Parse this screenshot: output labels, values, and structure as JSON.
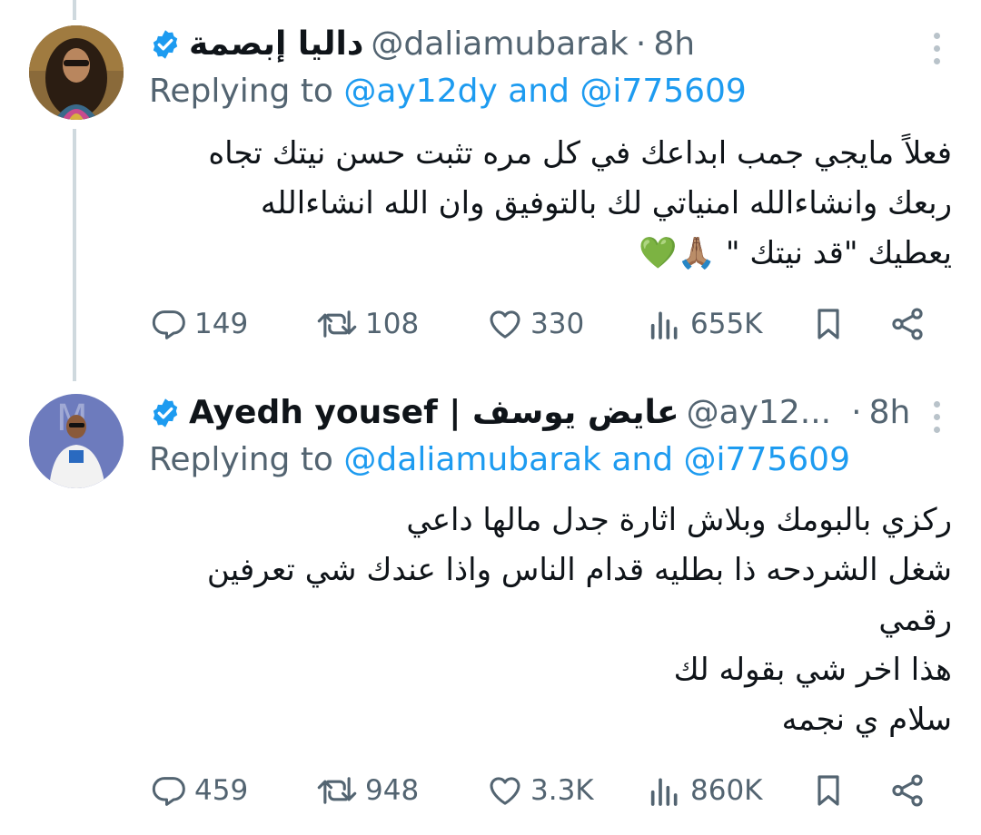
{
  "tweets": [
    {
      "display_name": "داليا إبصمة",
      "handle": "@daliamubarak",
      "separator": "·",
      "time": "8h",
      "replying_prefix": "Replying to",
      "replying_user1": "@ay12dy",
      "replying_and": "and",
      "replying_user2": "@i775609",
      "lines": [
        "فعلاً مايجي جمب ابداعك في كل مره تثبت حسن نيتك تجاه",
        "ربعك وانشاءالله امنياتي لك بالتوفيق وان الله انشاءالله",
        "يعطيك \"قد نيتك \" 🙏🏽💚"
      ],
      "stats": {
        "replies": "149",
        "retweets": "108",
        "likes": "330",
        "views": "655K"
      }
    },
    {
      "display_name": "Ayedh yousef | عايض يوسف",
      "handle": "@ay12...",
      "separator": "·",
      "time": "8h",
      "replying_prefix": "Replying to",
      "replying_user1": "@daliamubarak",
      "replying_and": "and",
      "replying_user2": "@i775609",
      "lines": [
        "ركزي بالبومك وبلاش اثارة جدل مالها داعي",
        "شغل الشردحه ذا بطليه قدام الناس واذا عندك شي تعرفين",
        "رقمي",
        "هذا اخر شي بقوله لك",
        "سلام ي نجمه"
      ],
      "stats": {
        "replies": "459",
        "retweets": "948",
        "likes": "3.3K",
        "views": "860K"
      }
    }
  ],
  "icons": {
    "verified": "verified-badge-icon",
    "reply": "reply-icon",
    "retweet": "retweet-icon",
    "like": "heart-icon",
    "views": "views-icon",
    "bookmark": "bookmark-icon",
    "share": "share-icon",
    "more": "more-icon"
  },
  "colors": {
    "accent": "#1d9bf0",
    "muted": "#536471",
    "text": "#0f1419",
    "thread_line": "#cfd9de"
  }
}
